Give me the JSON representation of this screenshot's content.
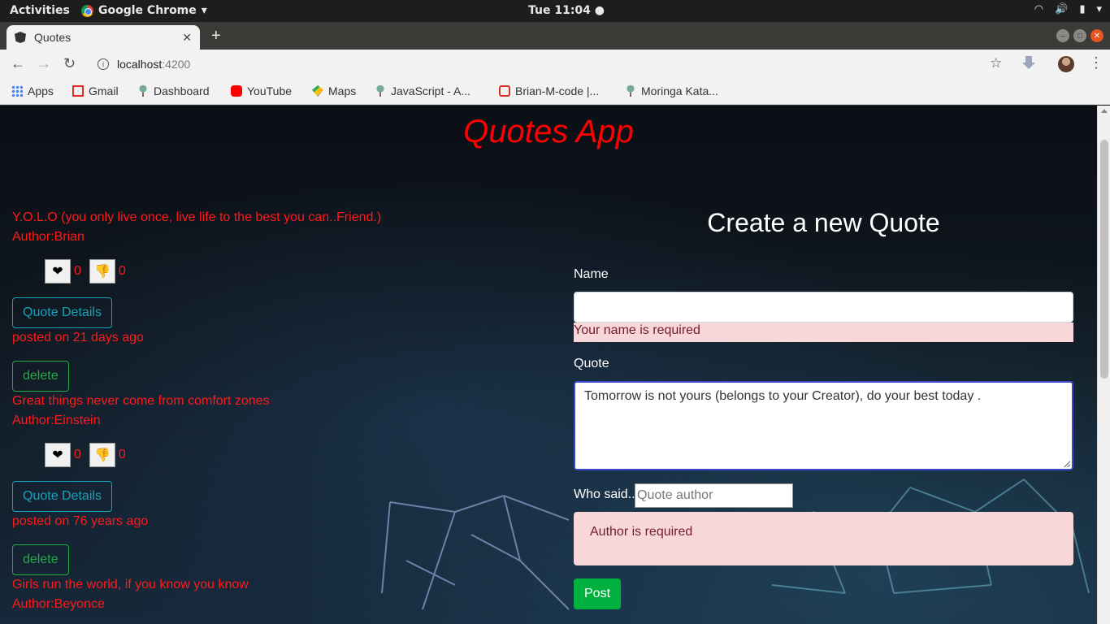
{
  "system": {
    "activities": "Activities",
    "app_name": "Google Chrome",
    "clock": "Tue 11:04"
  },
  "browser": {
    "tab_title": "Quotes",
    "url_host": "localhost",
    "url_port": ":4200",
    "bookmarks": [
      "Apps",
      "Gmail",
      "Dashboard",
      "YouTube",
      "Maps",
      "JavaScript - A...",
      "Brian-M-code |...",
      "Moringa Kata..."
    ]
  },
  "page": {
    "title": "Quotes App",
    "quotes": [
      {
        "text": "Y.O.L.O (you only live once, live life to the best you can..Friend.)",
        "author": "Author:Brian",
        "upvotes": "0",
        "downvotes": "0",
        "details_label": "Quote Details",
        "posted": "posted on 21 days ago",
        "delete_label": "delete"
      },
      {
        "text": "Great things never come from comfort zones",
        "author": "Author:Einstein",
        "upvotes": "0",
        "downvotes": "0",
        "details_label": "Quote Details",
        "posted": "posted on 76 years ago",
        "delete_label": "delete"
      },
      {
        "text": "Girls run the world, if you know you know",
        "author": "Author:Beyonce"
      }
    ],
    "form": {
      "title": "Create a new Quote",
      "name_label": "Name",
      "name_value": "",
      "name_error": "Your name is required",
      "quote_label": "Quote",
      "quote_value": "Tomorrow is not yours (belongs to your Creator), do your best today .",
      "author_label": "Who said..",
      "author_placeholder": "Quote author",
      "author_error": "Author is required",
      "submit_label": "Post"
    }
  }
}
